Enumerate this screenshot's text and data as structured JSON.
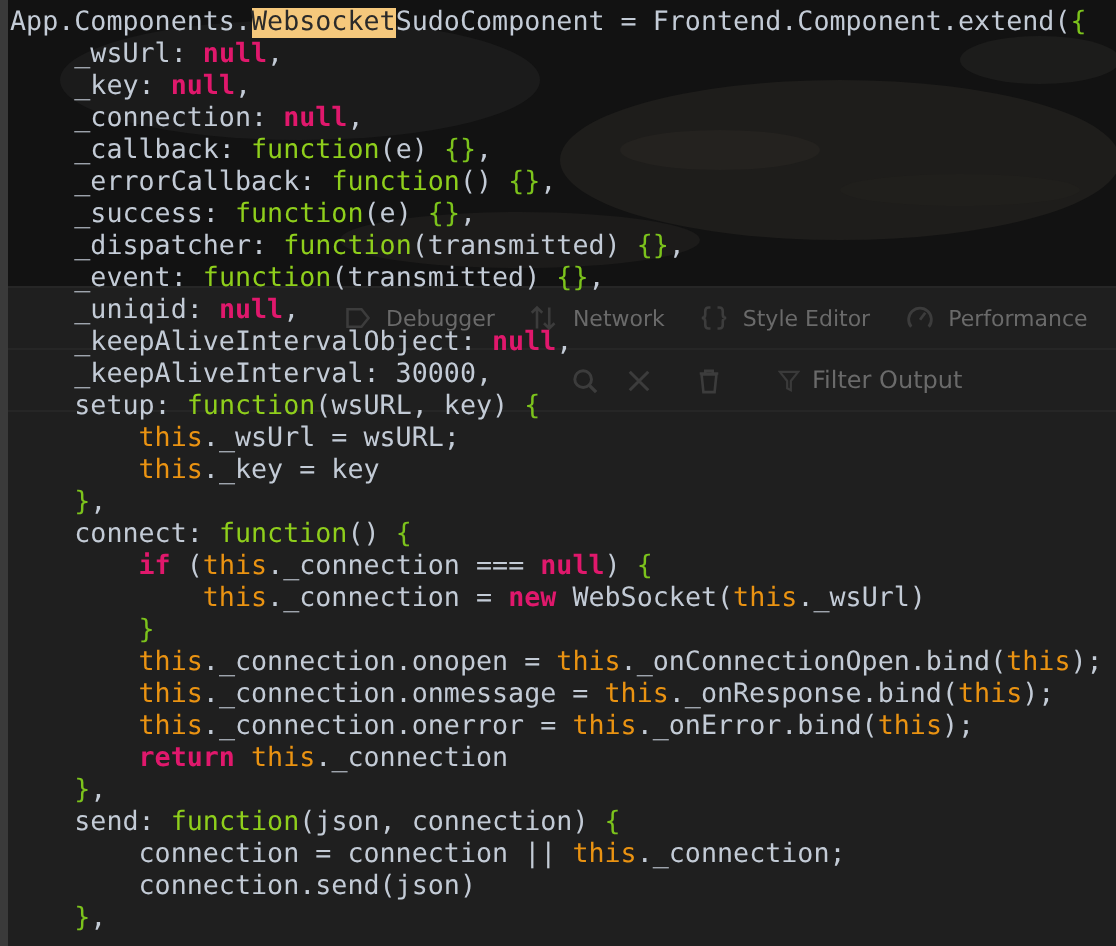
{
  "devtools": {
    "tabs": [
      {
        "label": "Debugger"
      },
      {
        "label": "Network"
      },
      {
        "label": "Style Editor"
      },
      {
        "label": "Performance"
      }
    ],
    "filter": {
      "placeholder": "Filter Output"
    }
  },
  "editor": {
    "lines": [
      [
        {
          "kind": "plain",
          "text": "App.Components."
        },
        {
          "kind": "match",
          "text": "Websocket"
        },
        {
          "kind": "plain",
          "text": "SudoComponent = Frontend.Component.extend("
        },
        {
          "kind": "brace",
          "text": "{"
        }
      ],
      [
        {
          "kind": "plain",
          "text": "    _wsUrl: "
        },
        {
          "kind": "keyword",
          "text": "null"
        },
        {
          "kind": "plain",
          "text": ","
        }
      ],
      [
        {
          "kind": "plain",
          "text": "    _key: "
        },
        {
          "kind": "keyword",
          "text": "null"
        },
        {
          "kind": "plain",
          "text": ","
        }
      ],
      [
        {
          "kind": "plain",
          "text": "    _connection: "
        },
        {
          "kind": "keyword",
          "text": "null"
        },
        {
          "kind": "plain",
          "text": ","
        }
      ],
      [
        {
          "kind": "plain",
          "text": "    _callback: "
        },
        {
          "kind": "func",
          "text": "function"
        },
        {
          "kind": "plain",
          "text": "(e) "
        },
        {
          "kind": "brace",
          "text": "{}"
        },
        {
          "kind": "plain",
          "text": ","
        }
      ],
      [
        {
          "kind": "plain",
          "text": "    _errorCallback: "
        },
        {
          "kind": "func",
          "text": "function"
        },
        {
          "kind": "plain",
          "text": "() "
        },
        {
          "kind": "brace",
          "text": "{}"
        },
        {
          "kind": "plain",
          "text": ","
        }
      ],
      [
        {
          "kind": "plain",
          "text": "    _success: "
        },
        {
          "kind": "func",
          "text": "function"
        },
        {
          "kind": "plain",
          "text": "(e) "
        },
        {
          "kind": "brace",
          "text": "{}"
        },
        {
          "kind": "plain",
          "text": ","
        }
      ],
      [
        {
          "kind": "plain",
          "text": "    _dispatcher: "
        },
        {
          "kind": "func",
          "text": "function"
        },
        {
          "kind": "plain",
          "text": "(transmitted) "
        },
        {
          "kind": "brace",
          "text": "{}"
        },
        {
          "kind": "plain",
          "text": ","
        }
      ],
      [
        {
          "kind": "plain",
          "text": "    _event: "
        },
        {
          "kind": "func",
          "text": "function"
        },
        {
          "kind": "plain",
          "text": "(transmitted) "
        },
        {
          "kind": "brace",
          "text": "{}"
        },
        {
          "kind": "plain",
          "text": ","
        }
      ],
      [
        {
          "kind": "plain",
          "text": "    _uniqid: "
        },
        {
          "kind": "keyword",
          "text": "null"
        },
        {
          "kind": "plain",
          "text": ","
        }
      ],
      [
        {
          "kind": "plain",
          "text": "    _keepAliveIntervalObject: "
        },
        {
          "kind": "keyword",
          "text": "null"
        },
        {
          "kind": "plain",
          "text": ","
        }
      ],
      [
        {
          "kind": "plain",
          "text": "    _keepAliveInterval: 30000,"
        }
      ],
      [
        {
          "kind": "plain",
          "text": "    setup: "
        },
        {
          "kind": "func",
          "text": "function"
        },
        {
          "kind": "plain",
          "text": "(wsURL, key) "
        },
        {
          "kind": "brace",
          "text": "{"
        }
      ],
      [
        {
          "kind": "this",
          "text": "        this"
        },
        {
          "kind": "plain",
          "text": "._wsUrl = wsURL;"
        }
      ],
      [
        {
          "kind": "this",
          "text": "        this"
        },
        {
          "kind": "plain",
          "text": "._key = key"
        }
      ],
      [
        {
          "kind": "brace",
          "text": "    }"
        },
        {
          "kind": "plain",
          "text": ","
        }
      ],
      [
        {
          "kind": "plain",
          "text": "    connect: "
        },
        {
          "kind": "func",
          "text": "function"
        },
        {
          "kind": "plain",
          "text": "() "
        },
        {
          "kind": "brace",
          "text": "{"
        }
      ],
      [
        {
          "kind": "keyword",
          "text": "        if"
        },
        {
          "kind": "plain",
          "text": " ("
        },
        {
          "kind": "this",
          "text": "this"
        },
        {
          "kind": "plain",
          "text": "._connection === "
        },
        {
          "kind": "keyword",
          "text": "null"
        },
        {
          "kind": "plain",
          "text": ") "
        },
        {
          "kind": "brace",
          "text": "{"
        }
      ],
      [
        {
          "kind": "this",
          "text": "            this"
        },
        {
          "kind": "plain",
          "text": "._connection = "
        },
        {
          "kind": "keyword",
          "text": "new"
        },
        {
          "kind": "plain",
          "text": " WebSocket("
        },
        {
          "kind": "this",
          "text": "this"
        },
        {
          "kind": "plain",
          "text": "._wsUrl)"
        }
      ],
      [
        {
          "kind": "brace",
          "text": "        }"
        }
      ],
      [
        {
          "kind": "this",
          "text": "        this"
        },
        {
          "kind": "plain",
          "text": "._connection.onopen = "
        },
        {
          "kind": "this",
          "text": "this"
        },
        {
          "kind": "plain",
          "text": "._onConnectionOpen.bind("
        },
        {
          "kind": "this",
          "text": "this"
        },
        {
          "kind": "plain",
          "text": ");"
        }
      ],
      [
        {
          "kind": "this",
          "text": "        this"
        },
        {
          "kind": "plain",
          "text": "._connection.onmessage = "
        },
        {
          "kind": "this",
          "text": "this"
        },
        {
          "kind": "plain",
          "text": "._onResponse.bind("
        },
        {
          "kind": "this",
          "text": "this"
        },
        {
          "kind": "plain",
          "text": ");"
        }
      ],
      [
        {
          "kind": "this",
          "text": "        this"
        },
        {
          "kind": "plain",
          "text": "._connection.onerror = "
        },
        {
          "kind": "this",
          "text": "this"
        },
        {
          "kind": "plain",
          "text": "._onError.bind("
        },
        {
          "kind": "this",
          "text": "this"
        },
        {
          "kind": "plain",
          "text": ");"
        }
      ],
      [
        {
          "kind": "keyword",
          "text": "        return"
        },
        {
          "kind": "this",
          "text": " this"
        },
        {
          "kind": "plain",
          "text": "._connection"
        }
      ],
      [
        {
          "kind": "brace",
          "text": "    }"
        },
        {
          "kind": "plain",
          "text": ","
        }
      ],
      [
        {
          "kind": "plain",
          "text": "    send: "
        },
        {
          "kind": "func",
          "text": "function"
        },
        {
          "kind": "plain",
          "text": "(json, connection) "
        },
        {
          "kind": "brace",
          "text": "{"
        }
      ],
      [
        {
          "kind": "plain",
          "text": "        connection = connection || "
        },
        {
          "kind": "this",
          "text": "this"
        },
        {
          "kind": "plain",
          "text": "._connection;"
        }
      ],
      [
        {
          "kind": "plain",
          "text": "        connection.send(json)"
        }
      ],
      [
        {
          "kind": "brace",
          "text": "    }"
        },
        {
          "kind": "plain",
          "text": ","
        }
      ]
    ]
  }
}
